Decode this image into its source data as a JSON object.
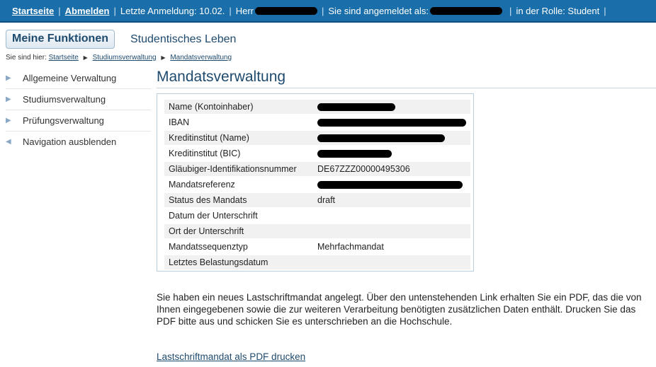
{
  "topbar": {
    "startseite": "Startseite",
    "abmelden": "Abmelden",
    "last_login": "Letzte Anmeldung: 10.02.",
    "herr": "Herr",
    "logged_in_as": "Sie sind angemeldet als:",
    "role": "in der Rolle: Student"
  },
  "tabs": {
    "active": "Meine Funktionen",
    "other": "Studentisches Leben"
  },
  "breadcrumb": {
    "prefix": "Sie sind hier:",
    "items": [
      "Startseite",
      "Studiumsverwaltung",
      "Mandatsverwaltung"
    ]
  },
  "sidebar": {
    "items": [
      {
        "label": "Allgemeine Verwaltung"
      },
      {
        "label": "Studiumsverwaltung"
      },
      {
        "label": "Prüfungsverwaltung"
      },
      {
        "label": "Navigation ausblenden"
      }
    ]
  },
  "main": {
    "title": "Mandatsverwaltung",
    "rows": [
      {
        "key": "Name (Kontoinhaber)",
        "value": "",
        "redacted": true
      },
      {
        "key": "IBAN",
        "value": "",
        "redacted": true
      },
      {
        "key": "Kreditinstitut (Name)",
        "value": "",
        "redacted": true
      },
      {
        "key": "Kreditinstitut (BIC)",
        "value": "",
        "redacted": true
      },
      {
        "key": "Gläubiger-Identifikationsnummer",
        "value": "DE67ZZZ00000495306",
        "redacted": false
      },
      {
        "key": "Mandatsreferenz",
        "value": "",
        "redacted": true
      },
      {
        "key": "Status des Mandats",
        "value": "draft",
        "redacted": false
      },
      {
        "key": "Datum der Unterschrift",
        "value": "",
        "redacted": false
      },
      {
        "key": "Ort der Unterschrift",
        "value": "",
        "redacted": false
      },
      {
        "key": "Mandatssequenztyp",
        "value": "Mehrfachmandat",
        "redacted": false
      },
      {
        "key": "Letztes Belastungsdatum",
        "value": "",
        "redacted": false
      }
    ],
    "info_text": "Sie haben ein neues Lastschriftmandat angelegt. Über den untenstehenden Link erhalten Sie ein PDF, das die von Ihnen eingegebenen sowie die zur weiteren Verarbeitung benötigten zusätzlichen Daten enthält. Drucken Sie das PDF bitte aus und schicken Sie es unterschrieben an die Hochschule.",
    "pdf_link": "Lastschriftmandat als PDF drucken"
  },
  "colors": {
    "topbar": "#1a6faa",
    "link": "#1e4a6e"
  }
}
